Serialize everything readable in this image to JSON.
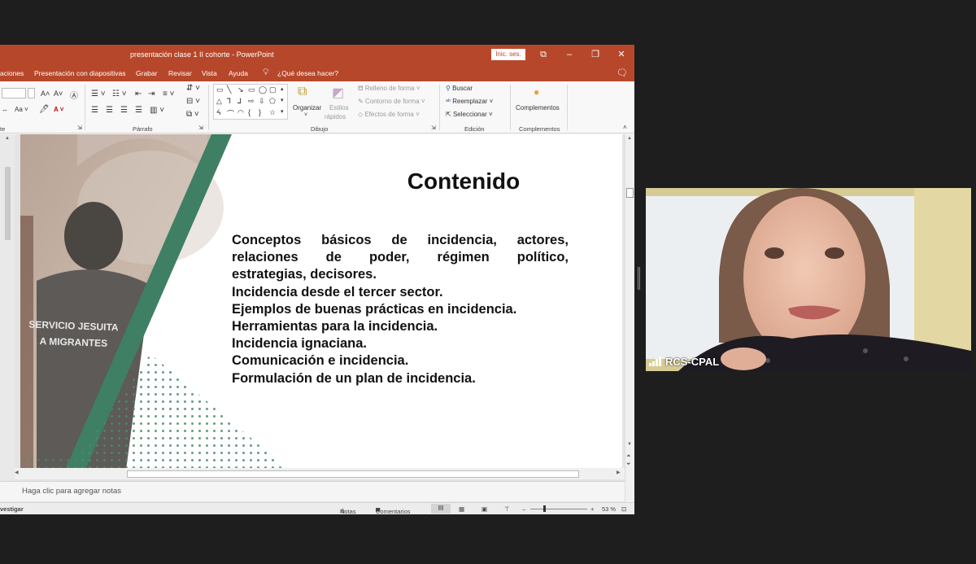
{
  "window": {
    "title": "presentación clase 1 II cohorte  -  PowerPoint",
    "sign_in": "Inic. ses."
  },
  "menu": {
    "items": [
      "aciones",
      "Presentación con diapositivas",
      "Grabar",
      "Revisar",
      "Vista",
      "Ayuda"
    ],
    "tell_me": "¿Qué desea hacer?"
  },
  "ribbon": {
    "groups": {
      "font_partial": "te",
      "paragraph": "Párrafo",
      "drawing": "Dibujo",
      "editing": "Edición",
      "addins": "Complementos"
    },
    "organize": "Organizar",
    "quick_styles_1": "Estilos",
    "quick_styles_2": "rápidos",
    "shape_fill": "Relleno de forma",
    "shape_outline": "Contorno de forma",
    "shape_effects": "Efectos de forma",
    "find": "Buscar",
    "replace": "Reemplazar",
    "select": "Seleccionar",
    "addins_button": "Complementos"
  },
  "slide": {
    "title": "Contenido",
    "photo_text_1": "SERVICIO JESUITA",
    "photo_text_2": "A MIGRANTES",
    "bullet_block_1": "Conceptos básicos de incidencia, actores, relaciones de poder, régimen político,",
    "bullet_block_1_last": "estrategias, decisores.",
    "bullets": [
      "Incidencia desde el tercer sector.",
      "Ejemplos de buenas prácticas en incidencia.",
      "Herramientas para la incidencia.",
      "Incidencia ignaciana.",
      "Comunicación e incidencia.",
      "Formulación de un plan de incidencia."
    ]
  },
  "notes": {
    "placeholder": "Haga clic para agregar notas"
  },
  "status": {
    "left": "vestigar",
    "notes": "Notas",
    "comments": "Comentarios",
    "zoom": "53 %"
  },
  "camera": {
    "participant": "RCS-CPAL"
  },
  "colors": {
    "ppt_accent": "#b7472a",
    "slide_green": "#3f7f64"
  }
}
